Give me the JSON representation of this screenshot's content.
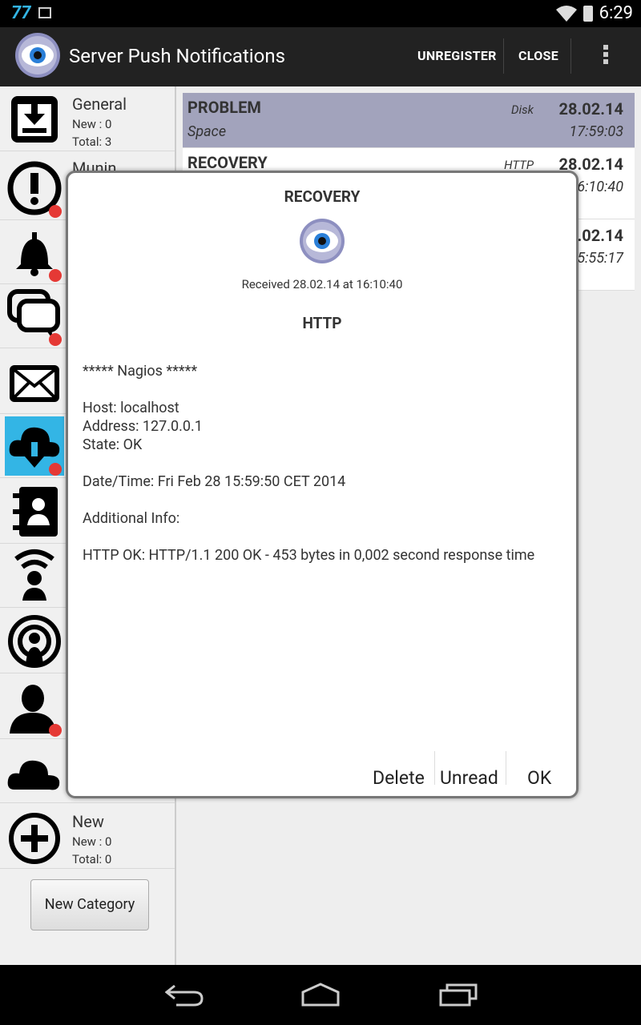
{
  "status_bar": {
    "notification_badge": "77",
    "time": "6:29"
  },
  "action_bar": {
    "title": "Server Push Notifications",
    "unregister_label": "UNREGISTER",
    "close_label": "CLOSE"
  },
  "categories": [
    {
      "name": "General",
      "new_label": "New :  0",
      "total_label": "Total: 3",
      "icon": "download-box-icon"
    },
    {
      "name": "Munin",
      "icon": "exclamation-icon"
    },
    {
      "icon": "bell-icon"
    },
    {
      "icon": "chat-icon"
    },
    {
      "icon": "mail-icon"
    },
    {
      "icon": "cloud-download-icon"
    },
    {
      "icon": "contacts-icon"
    },
    {
      "icon": "wireless-person-icon"
    },
    {
      "icon": "podcast-icon"
    },
    {
      "icon": "person-icon"
    },
    {
      "icon": "cloud-icon"
    },
    {
      "name": "New",
      "new_label": "New :  0",
      "total_label": "Total: 0",
      "icon": "add-circle-icon"
    }
  ],
  "new_category_label": "New Category",
  "messages": [
    {
      "type": "PROBLEM",
      "subject": "Space",
      "service": "Disk",
      "date": "28.02.14",
      "time": "17:59:03"
    },
    {
      "type": "RECOVERY",
      "subject": "",
      "service": "HTTP",
      "date": "28.02.14",
      "time": "16:10:40"
    },
    {
      "type": "",
      "subject": "",
      "service": "",
      "date": ".02.14",
      "time": "5:55:17"
    }
  ],
  "dialog": {
    "title": "RECOVERY",
    "received": "Received 28.02.14 at 16:10:40",
    "service": "HTTP",
    "body": {
      "line1": "***** Nagios *****",
      "host": "Host: localhost",
      "address": "Address: 127.0.0.1",
      "state": "State: OK",
      "datetime": "Date/Time: Fri Feb 28 15:59:50 CET 2014",
      "additional": "Additional Info:",
      "info": "HTTP OK: HTTP/1.1 200 OK - 453 bytes in 0,002 second response time"
    },
    "delete_label": "Delete",
    "unread_label": "Unread",
    "ok_label": "OK"
  },
  "colors": {
    "accent": "#33b5e5",
    "highlight_row": "#a2a3bc",
    "alert_badge": "#e53935"
  }
}
